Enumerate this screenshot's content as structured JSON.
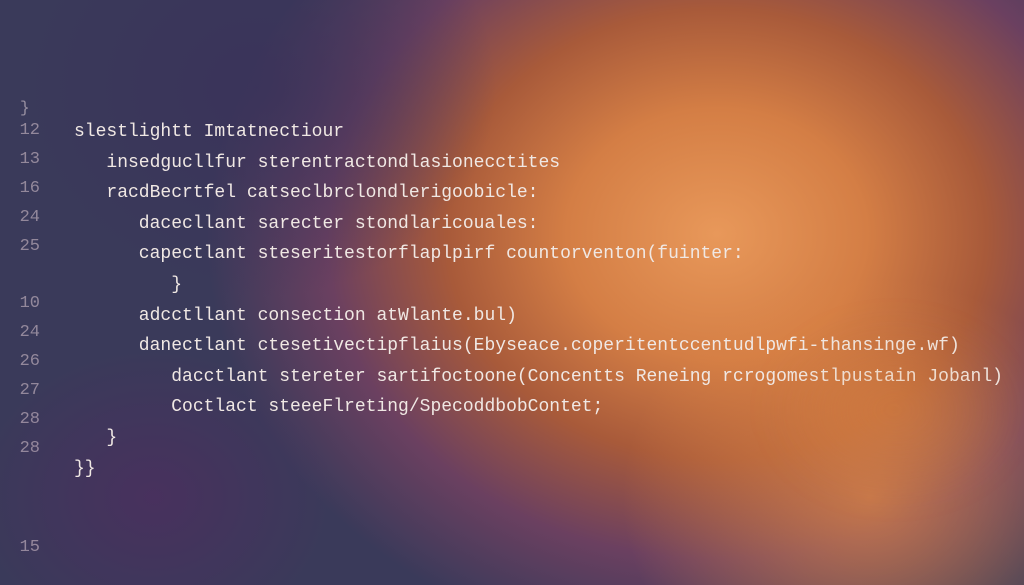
{
  "top_brace": "}",
  "lines": [
    {
      "num": "12",
      "indent": 0,
      "text": "slestlightt Imtatnectiour"
    },
    {
      "num": "13",
      "indent": 1,
      "text": "insedgucllfur sterentractondlasionecctites"
    },
    {
      "num": "16",
      "indent": 1,
      "text": "racdBecrtfel catseclbrclondlerigoobicle:"
    },
    {
      "num": "24",
      "indent": 2,
      "text": "dacecllant sarecter stondlaricouales:"
    },
    {
      "num": "25",
      "indent": 2,
      "text": "capectlant steseritestorflaplpirf countorventon(fuinter:"
    },
    {
      "num": "",
      "indent": 3,
      "text": "}"
    },
    {
      "num": "10",
      "indent": 2,
      "text": "adcctllant consection atWlante.bul)"
    },
    {
      "num": "24",
      "indent": 2,
      "text": "danectlant ctesetivectipflaius(Ebyseace.coperitentccentudlpwfi-thansinge.wf)"
    },
    {
      "num": "26",
      "indent": 3,
      "text": "dacctlant stereter sartifoctoone(Concentts Reneing rcrogomestlpustain Jobanl)"
    },
    {
      "num": "27",
      "indent": 3,
      "text": "Coctlact steeeFlreting/SpecoddbobContet;"
    },
    {
      "num": "28",
      "indent": 1,
      "text": "}"
    },
    {
      "num": "28",
      "indent": 0,
      "text": "}}"
    }
  ],
  "bottom_num": "15"
}
